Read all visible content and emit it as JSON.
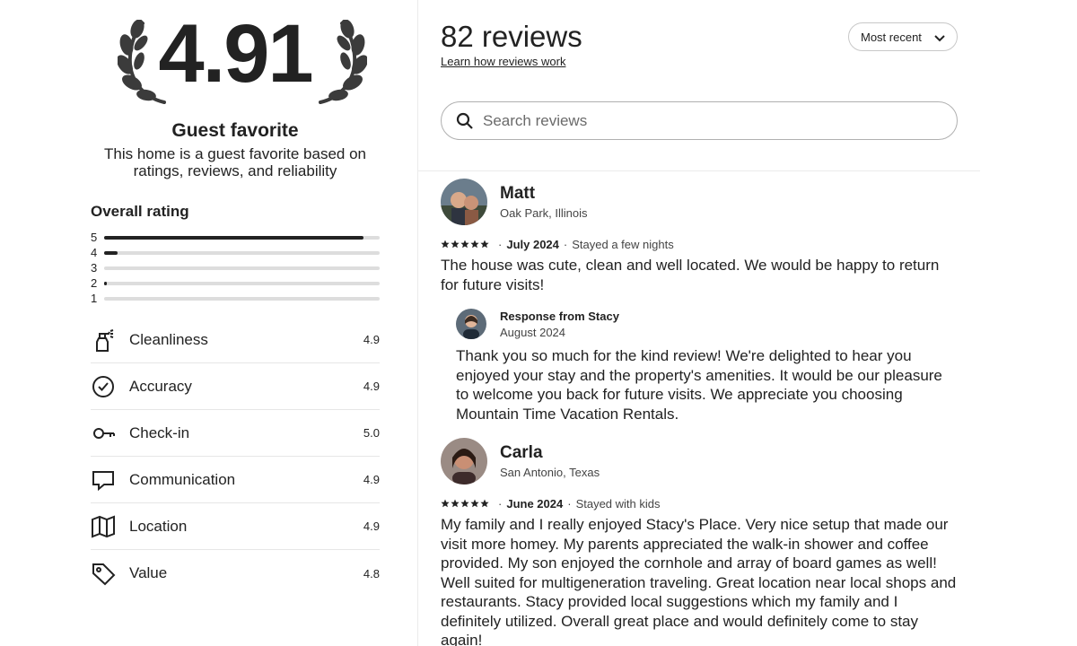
{
  "rating_summary": {
    "score": "4.91",
    "badge_title": "Guest favorite",
    "badge_description": "This home is a guest favorite based on ratings, reviews, and reliability",
    "overall_title": "Overall rating",
    "histogram": [
      {
        "label": "5",
        "fraction": 0.94
      },
      {
        "label": "4",
        "fraction": 0.05
      },
      {
        "label": "3",
        "fraction": 0.0
      },
      {
        "label": "2",
        "fraction": 0.01
      },
      {
        "label": "1",
        "fraction": 0.0
      }
    ],
    "categories": [
      {
        "label": "Cleanliness",
        "value": "4.9",
        "icon": "spray-bottle-icon"
      },
      {
        "label": "Accuracy",
        "value": "4.9",
        "icon": "check-circle-icon"
      },
      {
        "label": "Check-in",
        "value": "5.0",
        "icon": "key-icon"
      },
      {
        "label": "Communication",
        "value": "4.9",
        "icon": "chat-bubble-icon"
      },
      {
        "label": "Location",
        "value": "4.9",
        "icon": "map-icon"
      },
      {
        "label": "Value",
        "value": "4.8",
        "icon": "tag-icon"
      }
    ]
  },
  "reviews_header": {
    "count_label": "82 reviews",
    "learn_link": "Learn how reviews work",
    "sort_label": "Most recent",
    "search_placeholder": "Search reviews"
  },
  "reviews": [
    {
      "name": "Matt",
      "location": "Oak Park, Illinois",
      "stars": 5,
      "date": "July 2024",
      "stay": "Stayed a few nights",
      "text": "The house was cute, clean and well located. We would be happy to return for future visits!",
      "response": {
        "title": "Response from Stacy",
        "date": "August 2024",
        "text": "Thank you so much for the kind review! We're delighted to hear you enjoyed your stay and the property's amenities. It would be our pleasure to welcome you back for future visits. We appreciate you choosing Mountain Time Vacation Rentals."
      }
    },
    {
      "name": "Carla",
      "location": "San Antonio, Texas",
      "stars": 5,
      "date": "June 2024",
      "stay": "Stayed with kids",
      "text": "My family and I really enjoyed Stacy's Place. Very nice setup that made our visit more homey. My parents appreciated the walk-in shower and coffee provided. My son enjoyed the cornhole and array of board games as well! Well suited for multigeneration traveling. Great location near local shops and restaurants. Stacy provided local suggestions which my family and I definitely utilized. Overall great place and would definitely come to stay again!"
    }
  ],
  "colors": {
    "text": "#222222",
    "muted": "#444444",
    "border": "#b0b0b0",
    "bar": "#222222",
    "track": "#dddddd"
  }
}
